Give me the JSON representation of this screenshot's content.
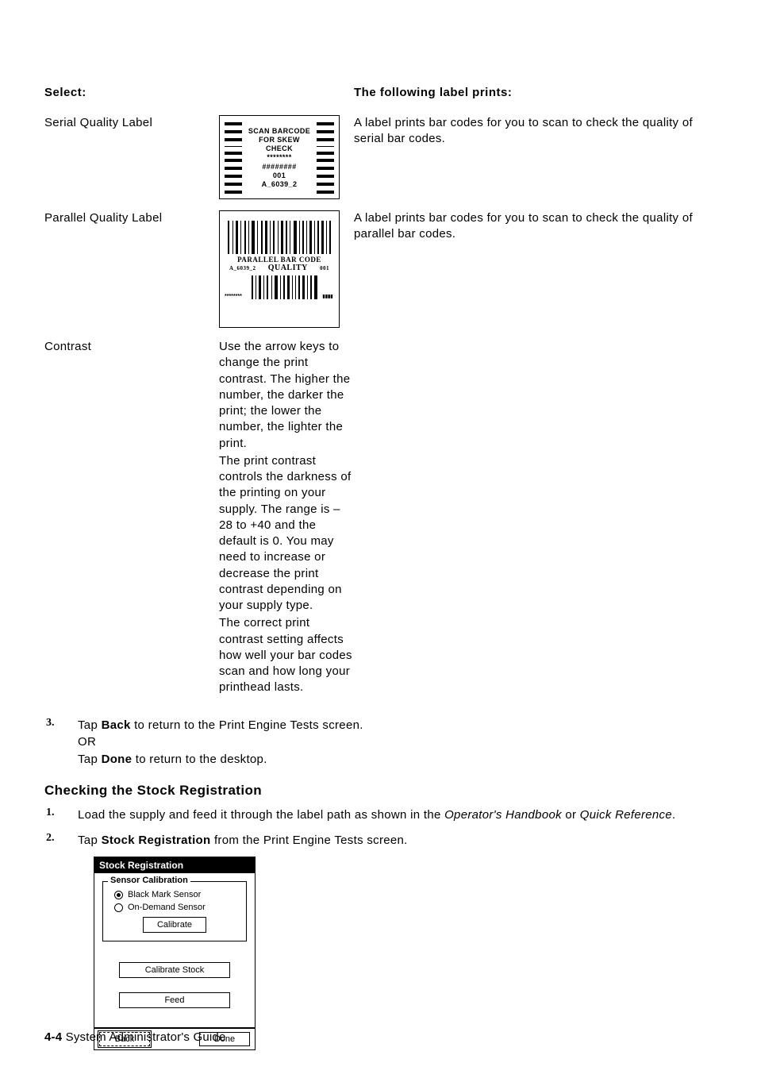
{
  "table": {
    "header": {
      "select": "Select:",
      "prints": "The following label prints:"
    },
    "rows": [
      {
        "select": "Serial Quality Label",
        "desc": "A label prints bar codes for you to scan to check the quality of serial bar codes.",
        "label_lines": [
          "SCAN BARCODE",
          "FOR SKEW",
          "CHECK",
          "********",
          "########",
          "001",
          "A_6039_2"
        ]
      },
      {
        "select": "Parallel Quality Label",
        "desc": "A label prints bar codes for you to scan to check the quality of parallel bar codes.",
        "parallel": {
          "line1": "PARALLEL BAR CODE",
          "left": "A_6039_2",
          "mid": "QUALITY",
          "right": "001",
          "bottom_left": "********"
        }
      },
      {
        "select": "Contrast",
        "desc_paras": [
          "Use the arrow keys to change the print contrast.  The higher the number, the darker the print; the lower the number, the lighter the print.",
          "The print contrast controls the darkness of the printing on your supply. The range is –28 to +40 and the default is 0.  You may need to increase or decrease the print contrast depending on your supply type.",
          "The correct print contrast setting affects how well your bar codes scan and how long your printhead lasts."
        ]
      }
    ]
  },
  "step3": {
    "num": "3.",
    "pre": "Tap ",
    "back": "Back",
    "mid1": " to return to the Print Engine Tests screen.",
    "or": "OR",
    "pre2": "Tap ",
    "done": "Done",
    "mid2": " to return to the desktop."
  },
  "section_heading": "Checking the Stock Registration",
  "steps_b": [
    {
      "num": "1.",
      "parts": {
        "a": "Load the supply and feed it through the label path as shown in the ",
        "i1": "Operator's Handbook",
        "b": " or ",
        "i2": "Quick Reference",
        "c": "."
      }
    },
    {
      "num": "2.",
      "parts": {
        "a": "Tap ",
        "bold": "Stock Registration",
        "b": " from the Print Engine Tests screen."
      }
    }
  ],
  "screenshot": {
    "title": "Stock Registration",
    "legend": "Sensor Calibration",
    "radio1": "Black Mark Sensor",
    "radio2": "On-Demand Sensor",
    "btn_calibrate": "Calibrate",
    "btn_calstock": "Calibrate Stock",
    "btn_feed": "Feed",
    "btn_back": "Back",
    "btn_done": "Done"
  },
  "footer": {
    "page": "4-4",
    "title": " System Administrator's Guide"
  }
}
